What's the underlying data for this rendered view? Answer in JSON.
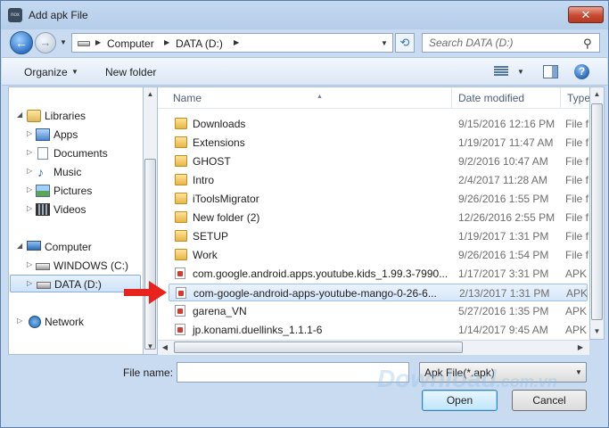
{
  "window": {
    "title": "Add apk File",
    "close_label": "✕"
  },
  "address": {
    "crumbs": [
      "Computer",
      "DATA (D:)"
    ],
    "search_placeholder": "Search DATA (D:)"
  },
  "toolbar": {
    "organize_label": "Organize",
    "new_folder_label": "New folder"
  },
  "nav": {
    "libraries": "Libraries",
    "apps": "Apps",
    "documents": "Documents",
    "music": "Music",
    "pictures": "Pictures",
    "videos": "Videos",
    "computer": "Computer",
    "windows_drive": "WINDOWS (C:)",
    "data_drive": "DATA (D:)",
    "network": "Network"
  },
  "columns": {
    "name": "Name",
    "date": "Date modified",
    "type": "Type"
  },
  "files": [
    {
      "name": "Downloads",
      "date": "9/15/2016 12:16 PM",
      "type": "File f",
      "kind": "folder"
    },
    {
      "name": "Extensions",
      "date": "1/19/2017 11:47 AM",
      "type": "File f",
      "kind": "folder"
    },
    {
      "name": "GHOST",
      "date": "9/2/2016 10:47 AM",
      "type": "File f",
      "kind": "folder"
    },
    {
      "name": "Intro",
      "date": "2/4/2017 11:28 AM",
      "type": "File f",
      "kind": "folder"
    },
    {
      "name": "iToolsMigrator",
      "date": "9/26/2016 1:55 PM",
      "type": "File f",
      "kind": "folder"
    },
    {
      "name": "New folder (2)",
      "date": "12/26/2016 2:55 PM",
      "type": "File f",
      "kind": "folder"
    },
    {
      "name": "SETUP",
      "date": "1/19/2017 1:31 PM",
      "type": "File f",
      "kind": "folder"
    },
    {
      "name": "Work",
      "date": "9/26/2016 1:54 PM",
      "type": "File f",
      "kind": "folder"
    },
    {
      "name": "com.google.android.apps.youtube.kids_1.99.3-7990...",
      "date": "1/17/2017 3:31 PM",
      "type": "APK",
      "kind": "apk"
    },
    {
      "name": "com-google-android-apps-youtube-mango-0-26-6...",
      "date": "2/13/2017 1:31 PM",
      "type": "APK",
      "kind": "apk"
    },
    {
      "name": "garena_VN",
      "date": "5/27/2016 1:35 PM",
      "type": "APK",
      "kind": "apk"
    },
    {
      "name": "jp.konami.duellinks_1.1.1-6",
      "date": "1/14/2017 9:45 AM",
      "type": "APK",
      "kind": "apk"
    }
  ],
  "bottom": {
    "file_name_label": "File name:",
    "file_name_value": "",
    "file_type_label": "Apk File(*.apk)",
    "open_label": "Open",
    "cancel_label": "Cancel"
  },
  "watermark": {
    "main": "Download",
    "suffix": ".com.vn"
  }
}
